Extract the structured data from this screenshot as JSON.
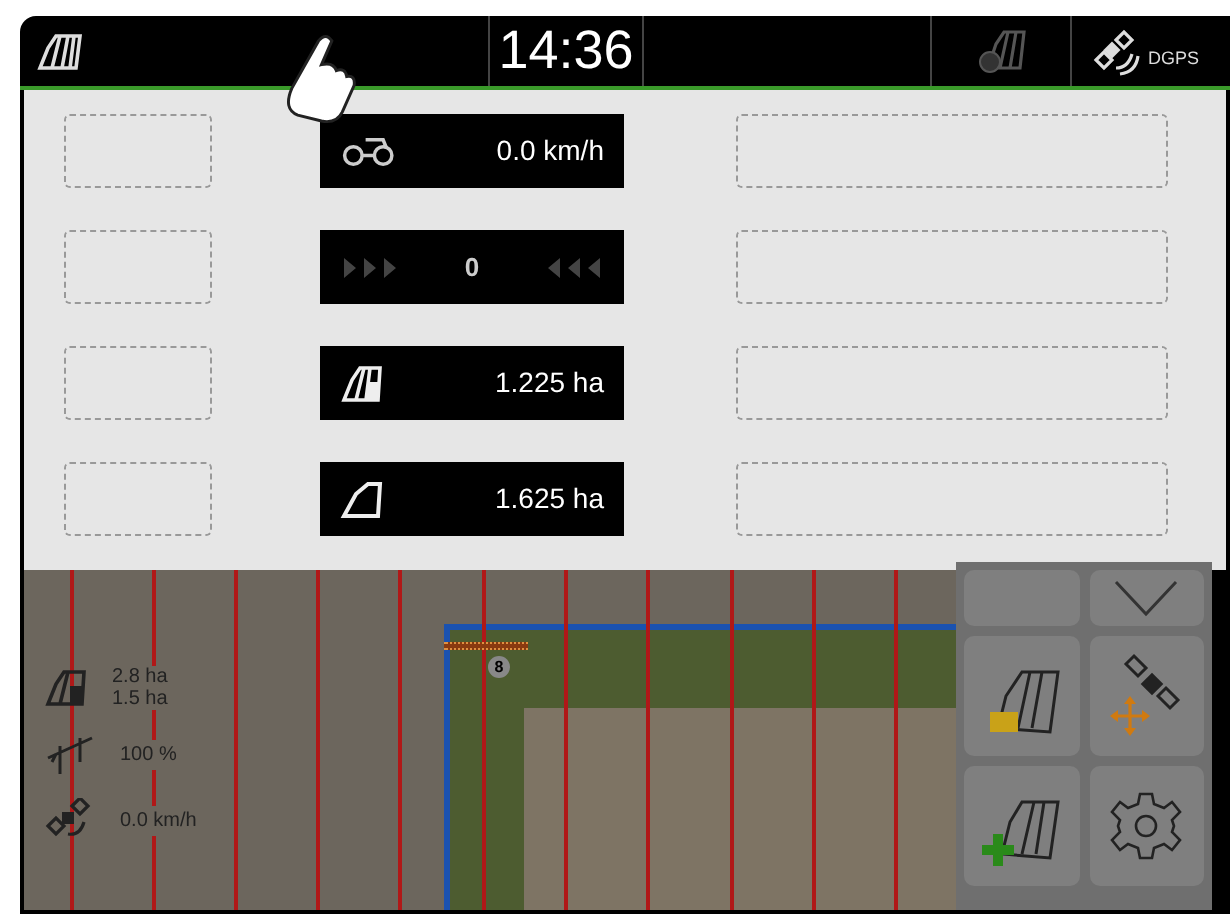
{
  "status_bar": {
    "time": "14:36",
    "gps_label": "DGPS"
  },
  "panel": {
    "instruments": [
      {
        "kind": "speed",
        "value": "0.0 km/h"
      },
      {
        "kind": "sections",
        "value": "0"
      },
      {
        "kind": "area_worked",
        "value": "1.225 ha"
      },
      {
        "kind": "area_total",
        "value": "1.625 ha"
      }
    ]
  },
  "map": {
    "area_lines": [
      "2.8 ha",
      "1.5 ha"
    ],
    "rate": "100 %",
    "speed": "0.0 km/h",
    "boom_marker": "8"
  }
}
